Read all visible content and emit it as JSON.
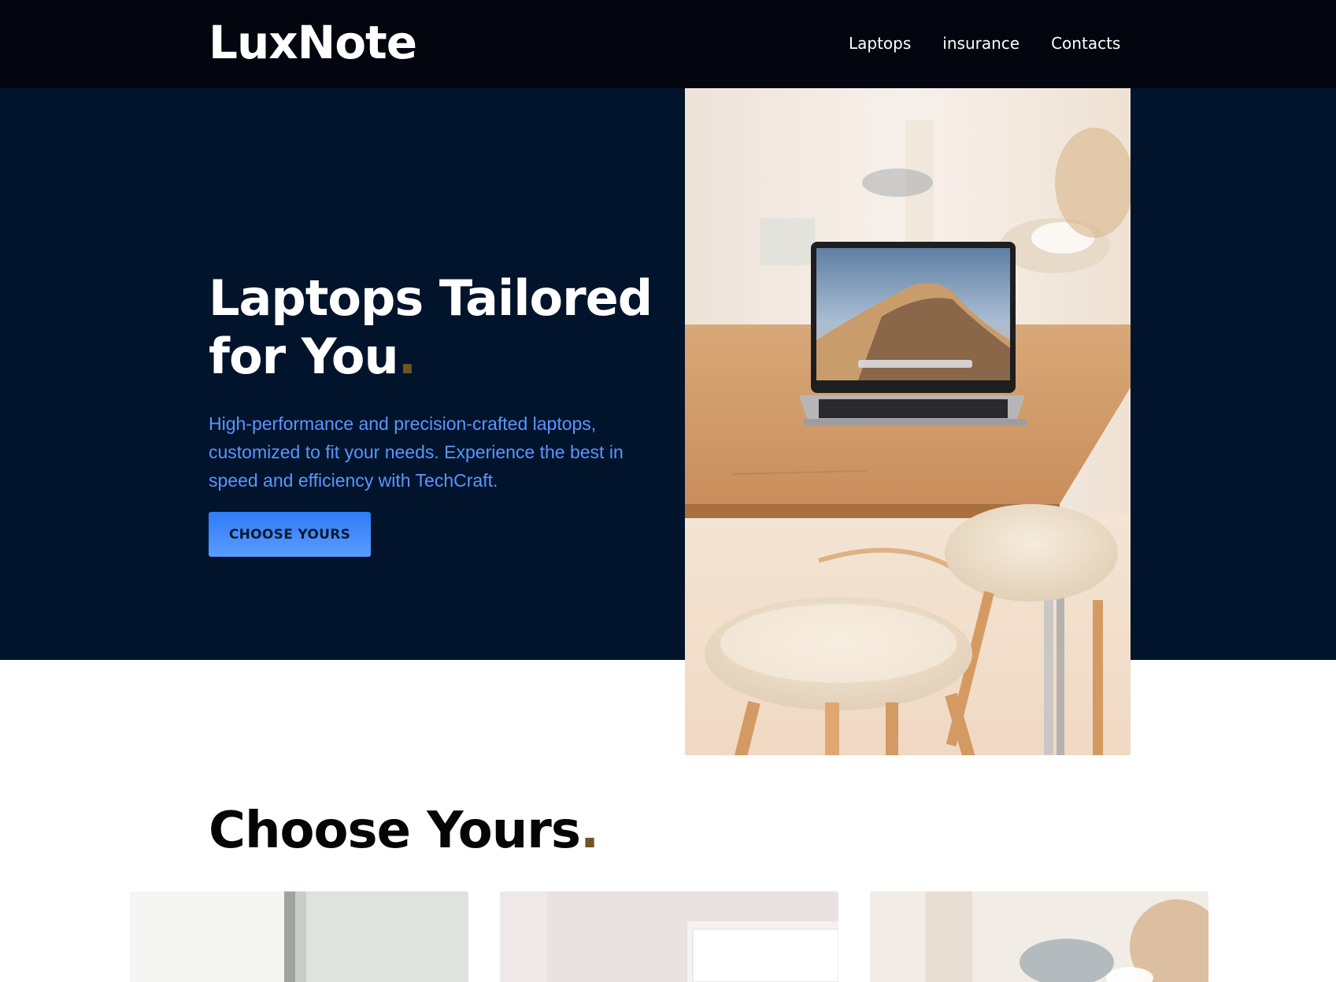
{
  "header": {
    "logo": "LuxNote",
    "nav": [
      {
        "label": "Laptops"
      },
      {
        "label": "insurance"
      },
      {
        "label": "Contacts"
      }
    ]
  },
  "hero": {
    "title_line1": "Laptops Tailored",
    "title_line2": "for You",
    "title_dot": ".",
    "description": "High-performance and precision-crafted laptops, customized to fit your needs. Experience the best in speed and efficiency with TechCraft.",
    "cta_label": "CHOOSE YOURS",
    "image": "laptop-on-wooden-table-photo"
  },
  "choose": {
    "title": "Choose Yours",
    "title_dot": ".",
    "cards": [
      {
        "image": "laptop-photo-1"
      },
      {
        "image": "laptop-photo-2"
      },
      {
        "image": "laptop-photo-3"
      }
    ]
  },
  "colors": {
    "header_bg": "#03060f",
    "hero_bg": "#02142c",
    "accent_blue": "#5a95ff",
    "accent_dot": "#6e5624"
  }
}
